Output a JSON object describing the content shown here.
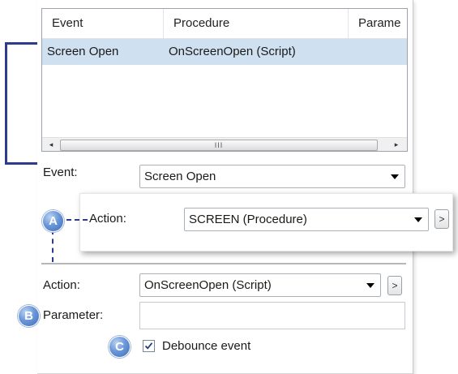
{
  "list": {
    "columns": [
      "Event",
      "Procedure",
      "Parame"
    ],
    "rows": [
      {
        "event": "Screen Open",
        "procedure": "OnScreenOpen (Script)",
        "parameter": ""
      }
    ],
    "scroll_left": "◂",
    "scroll_right": "▸",
    "scroll_grip": "III"
  },
  "event_field": {
    "label": "Event:",
    "value": "Screen Open"
  },
  "callout": {
    "badge": "A",
    "label": "Action:",
    "value": "SCREEN (Procedure)",
    "more_button": ">"
  },
  "action_field": {
    "label": "Action:",
    "value": "OnScreenOpen (Script)",
    "more_button": ">"
  },
  "parameter_field": {
    "badge": "B",
    "label": "Parameter:",
    "value": ""
  },
  "debounce": {
    "badge": "C",
    "label": "Debounce event",
    "checked": true
  },
  "colors": {
    "bracket": "#2d3c8c",
    "selection": "#cfe0f0",
    "badge": "#5b86cc"
  }
}
